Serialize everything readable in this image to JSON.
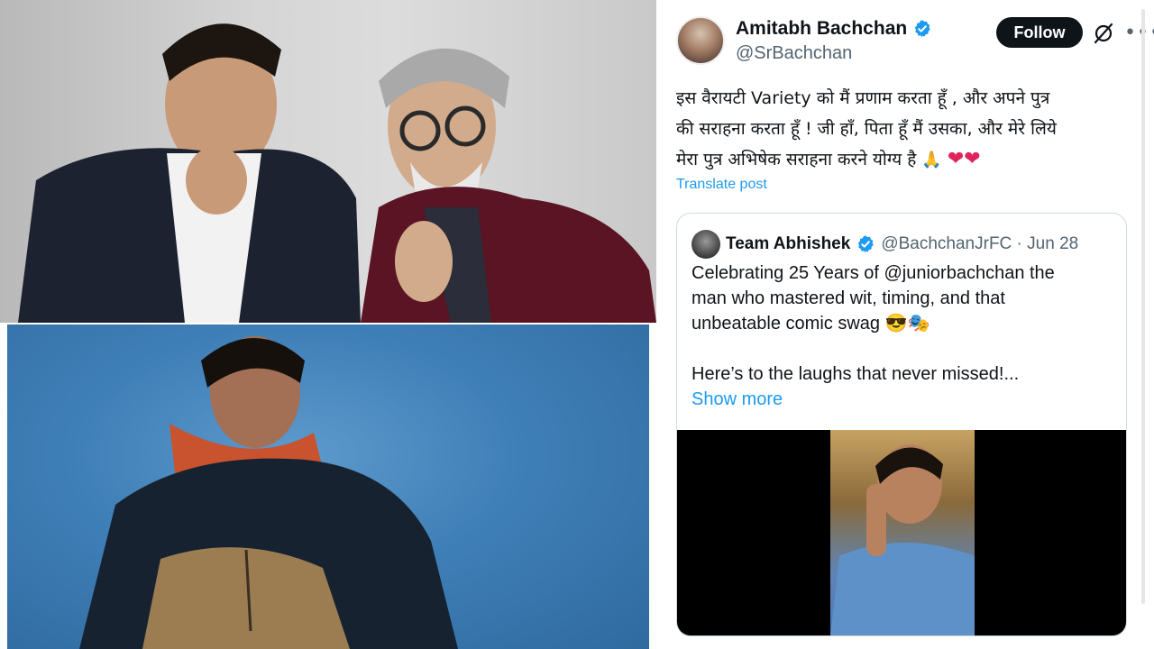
{
  "photos": {
    "top": "photo-father-son",
    "bottom": "photo-son-in-shawl"
  },
  "tweet": {
    "display_name": "Amitabh Bachchan",
    "handle": "@SrBachchan",
    "follow_label": "Follow",
    "text_line1": "इस वैरायटी Variety को मैं प्रणाम करता हूँ  , और अपने पुत्र",
    "text_line2": "की सराहना करता हूँ  ! जी हाँ, पिता हूँ मैं उसका, और मेरे लिये",
    "text_line3": "मेरा पुत्र अभिषेक सराहना करने योग्य है",
    "emoji_hands": "🙏",
    "hearts": "❤❤",
    "translate_label": "Translate post",
    "icons": {
      "verified": "verified-badge-icon",
      "grok": "grok-icon",
      "more": "more-options-icon"
    },
    "colors": {
      "accent": "#1d9bf0",
      "text": "#0f1419",
      "muted": "#536471",
      "follow_bg": "#0f1419",
      "heart": "#e0245e"
    }
  },
  "quote": {
    "display_name": "Team Abhishek",
    "handle_time": "@BachchanJrFC · Jun 28",
    "line1": "Celebrating 25 Years of @juniorbachchan the",
    "line2": "man who mastered wit, timing, and that",
    "line3": "unbeatable comic swag",
    "line3_emoji": "😎🎭",
    "line4": "Here’s to the laughs that never missed!...",
    "show_more": "Show more"
  }
}
